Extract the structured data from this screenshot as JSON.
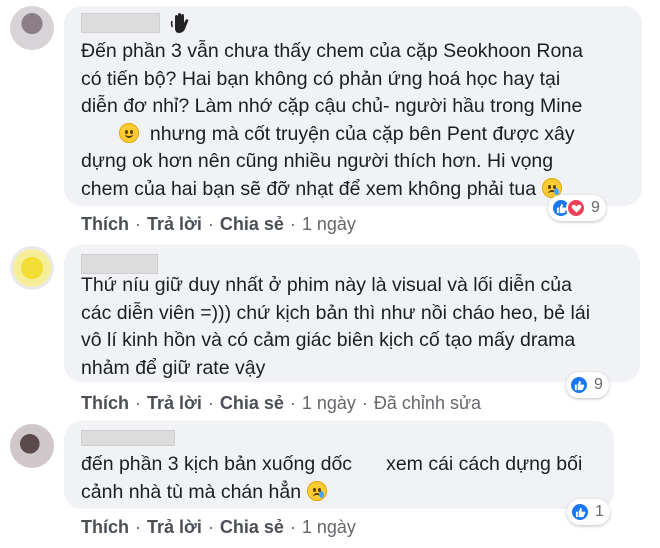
{
  "comments": [
    {
      "lines": [
        "Đến phần 3 vẫn chưa thấy chem của cặp Seokhoon Rona",
        "có tiến bộ? Hai bạn không có phản ứng hoá học hay tại",
        "diễn đơ nhỉ? Làm nhớ cặp cậu chủ- người hầu trong Mine",
        "nhưng mà cốt truyện của cặp bên Pent được xây",
        "dựng ok hơn nên cũng nhiều người thích hơn. Hi vọng",
        "chem của hai bạn sẽ đỡ nhạt để xem không phải tua"
      ],
      "actions": {
        "like": "Thích",
        "reply": "Trả lời",
        "share": "Chia sẻ",
        "time": "1 ngày"
      },
      "reaction_count": "9"
    },
    {
      "lines": [
        "Thứ níu giữ duy nhất ở phim này là visual và lối diễn của",
        "các diễn viên =))) chứ kịch bản thì như nồi cháo heo, bẻ lái",
        "vô lí kinh hồn và có cảm giác biên kịch cố tạo mấy drama",
        "nhảm để giữ rate vậy"
      ],
      "actions": {
        "like": "Thích",
        "reply": "Trả lời",
        "share": "Chia sẻ",
        "time": "1 ngày",
        "edited": "Đã chỉnh sửa"
      },
      "reaction_count": "9"
    },
    {
      "lines": [
        "đến phần 3 kịch bản xuống dốc",
        "xem cái cách dựng bối",
        "cảnh nhà tù mà chán hẳn"
      ],
      "actions": {
        "like": "Thích",
        "reply": "Trả lời",
        "share": "Chia sẻ",
        "time": "1 ngày"
      },
      "reaction_count": "1"
    }
  ],
  "colors": {
    "bubble": "#f0f2f5",
    "like": "#1877f2",
    "love": "#f33e58",
    "meta": "#65676b"
  },
  "icons": [
    "wave-hand-icon",
    "smile-emoji-icon",
    "sweat-smile-emoji-icon",
    "crying-emoji-icon",
    "like-reaction-icon",
    "love-reaction-icon"
  ]
}
